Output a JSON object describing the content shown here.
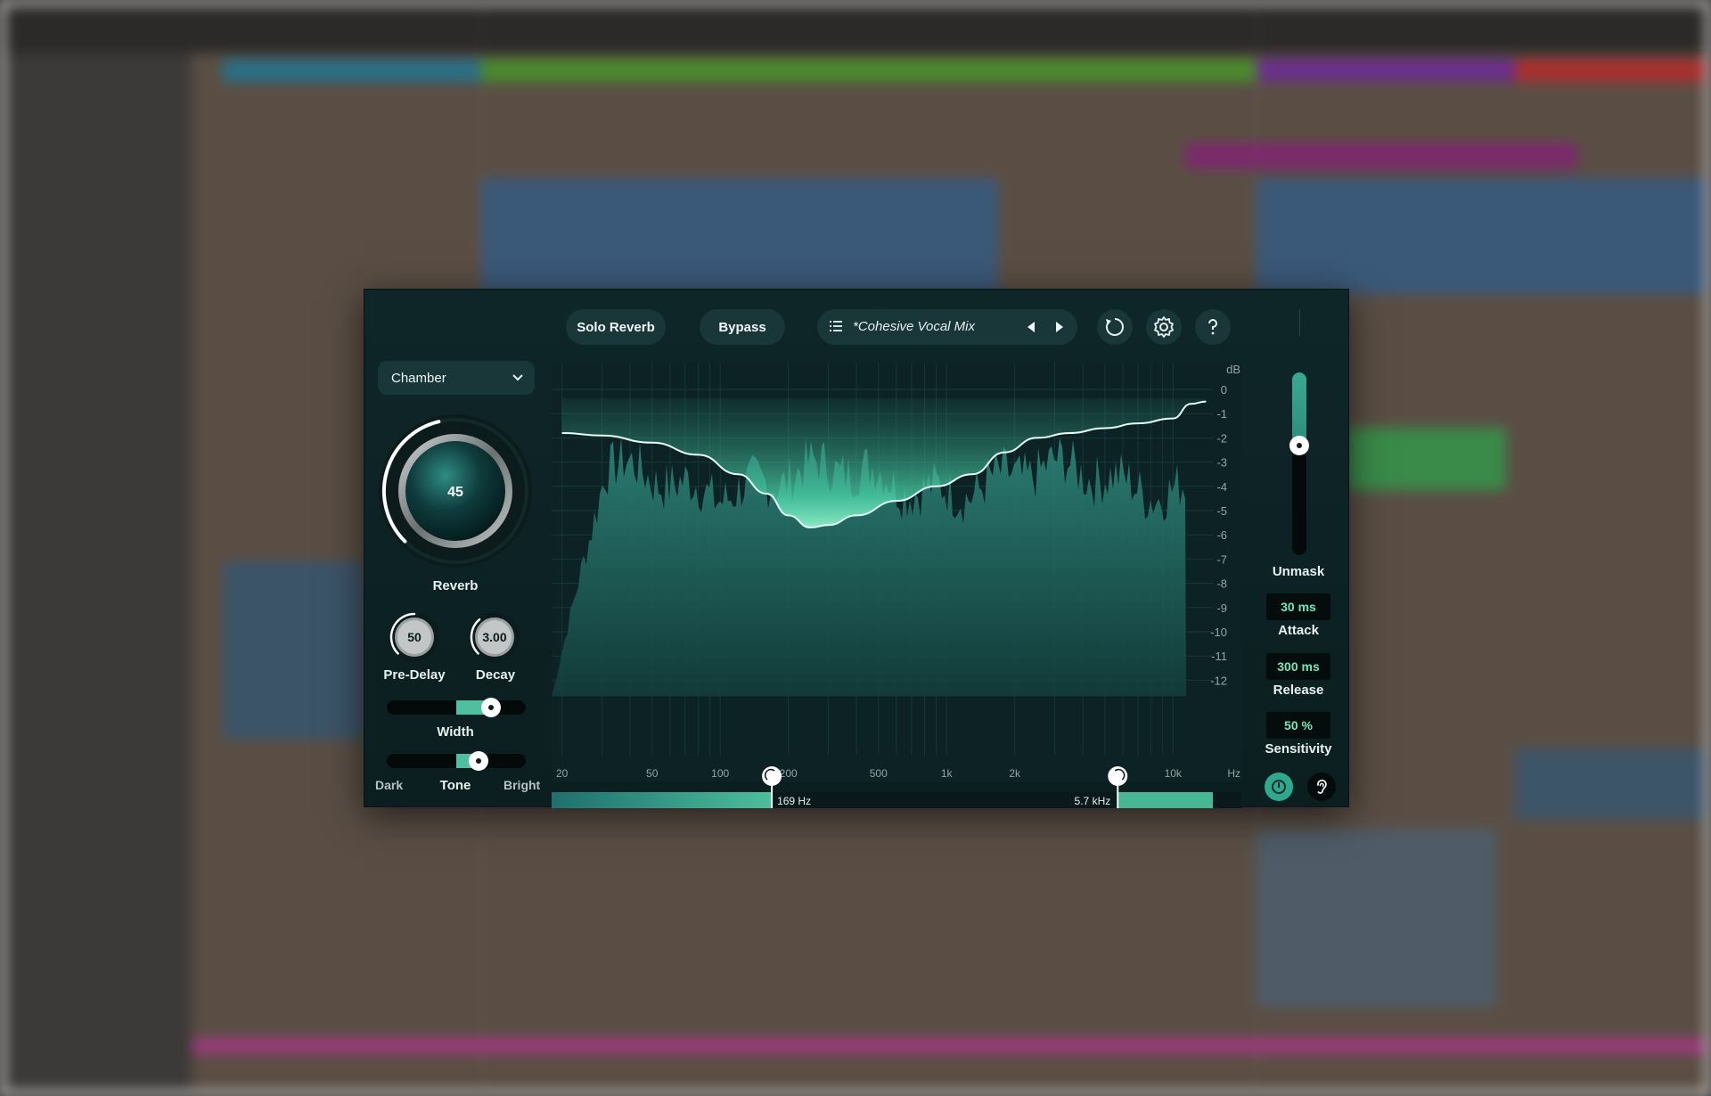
{
  "toolbar": {
    "solo_reverb_label": "Solo Reverb",
    "bypass_label": "Bypass",
    "preset_name": "*Cohesive Vocal Mix",
    "icons": [
      "list-icon",
      "prev-preset-icon",
      "next-preset-icon",
      "history-icon",
      "gear-icon",
      "help-icon"
    ]
  },
  "reverb": {
    "mode": "Chamber",
    "amount": {
      "value": "45",
      "label": "Reverb",
      "fraction": 0.45
    },
    "pre_delay": {
      "value": "50",
      "label": "Pre-Delay",
      "fraction": 0.5
    },
    "decay": {
      "value": "3.00",
      "label": "Decay",
      "fraction": 0.35
    },
    "width": {
      "label": "Width",
      "fraction": 0.75
    },
    "tone": {
      "label": "Tone",
      "left": "Dark",
      "right": "Bright",
      "fraction": 0.66
    }
  },
  "graph": {
    "db_unit": "dB",
    "db_ticks": [
      "0",
      "-1",
      "-2",
      "-3",
      "-4",
      "-5",
      "-6",
      "-7",
      "-8",
      "-9",
      "-10",
      "-11",
      "-12"
    ],
    "freq_unit": "Hz",
    "freq_ticks": [
      {
        "label": "20",
        "hz": 20
      },
      {
        "label": "50",
        "hz": 50
      },
      {
        "label": "100",
        "hz": 100
      },
      {
        "label": "200",
        "hz": 200
      },
      {
        "label": "500",
        "hz": 500
      },
      {
        "label": "1k",
        "hz": 1000
      },
      {
        "label": "2k",
        "hz": 2000
      },
      {
        "label": "10k",
        "hz": 10000
      }
    ],
    "low_cut": {
      "label": "169 Hz",
      "hz": 169
    },
    "high_cut": {
      "label": "5.7 kHz",
      "hz": 5700
    },
    "curve": [
      [
        20,
        -1.8
      ],
      [
        30,
        -1.9
      ],
      [
        50,
        -2.2
      ],
      [
        80,
        -2.7
      ],
      [
        120,
        -3.5
      ],
      [
        160,
        -4.3
      ],
      [
        200,
        -5.2
      ],
      [
        250,
        -5.7
      ],
      [
        300,
        -5.6
      ],
      [
        400,
        -5.2
      ],
      [
        600,
        -4.6
      ],
      [
        900,
        -4.0
      ],
      [
        1300,
        -3.5
      ],
      [
        1800,
        -2.6
      ],
      [
        2500,
        -2.0
      ],
      [
        3500,
        -1.8
      ],
      [
        5000,
        -1.6
      ],
      [
        7000,
        -1.4
      ],
      [
        10000,
        -1.2
      ],
      [
        12000,
        -0.6
      ],
      [
        14000,
        -0.5
      ]
    ]
  },
  "unmask": {
    "label": "Unmask",
    "fraction": 0.6,
    "attack": {
      "value": "30 ms",
      "label": "Attack"
    },
    "release": {
      "value": "300 ms",
      "label": "Release"
    },
    "sensitivity": {
      "value": "50 %",
      "label": "Sensitivity"
    }
  }
}
